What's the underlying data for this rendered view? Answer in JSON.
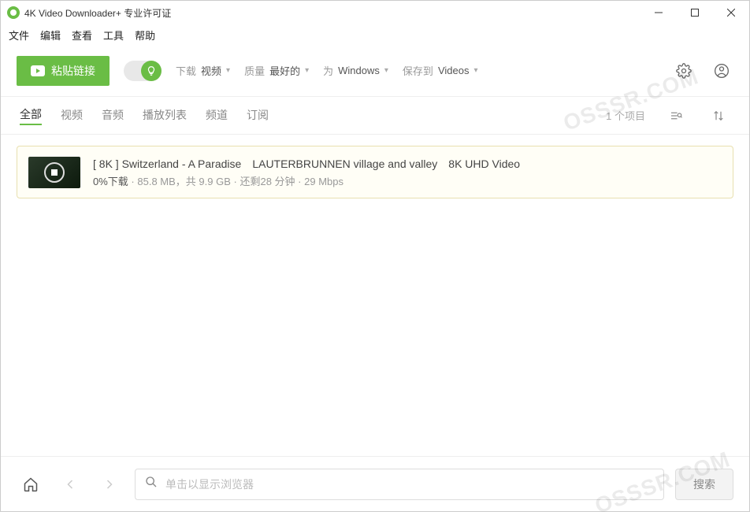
{
  "window": {
    "title": "4K Video Downloader+ 专业许可证"
  },
  "menu": {
    "file": "文件",
    "edit": "编辑",
    "view": "查看",
    "tools": "工具",
    "help": "帮助"
  },
  "toolbar": {
    "paste_label": "粘贴链接",
    "download_label": "下载",
    "download_value": "视频",
    "quality_label": "质量",
    "quality_value": "最好的",
    "for_label": "为",
    "for_value": "Windows",
    "saveto_label": "保存到",
    "saveto_value": "Videos"
  },
  "tabs": {
    "all": "全部",
    "video": "视频",
    "audio": "音频",
    "playlist": "播放列表",
    "channel": "频道",
    "subscribe": "订阅",
    "count": "1 个项目"
  },
  "download_item": {
    "title": "[ 8K ] Switzerland - A Paradise　LAUTERBRUNNEN village and valley　8K UHD Video",
    "percent": "0%下载",
    "size": "85.8 MB",
    "total_sep": "，共 ",
    "total": "9.9 GB",
    "eta": "还剩28 分钟",
    "speed": "29 Mbps"
  },
  "bottom": {
    "placeholder": "单击以显示浏览器",
    "search_btn": "搜索"
  },
  "watermark": "OSSSR.COM"
}
